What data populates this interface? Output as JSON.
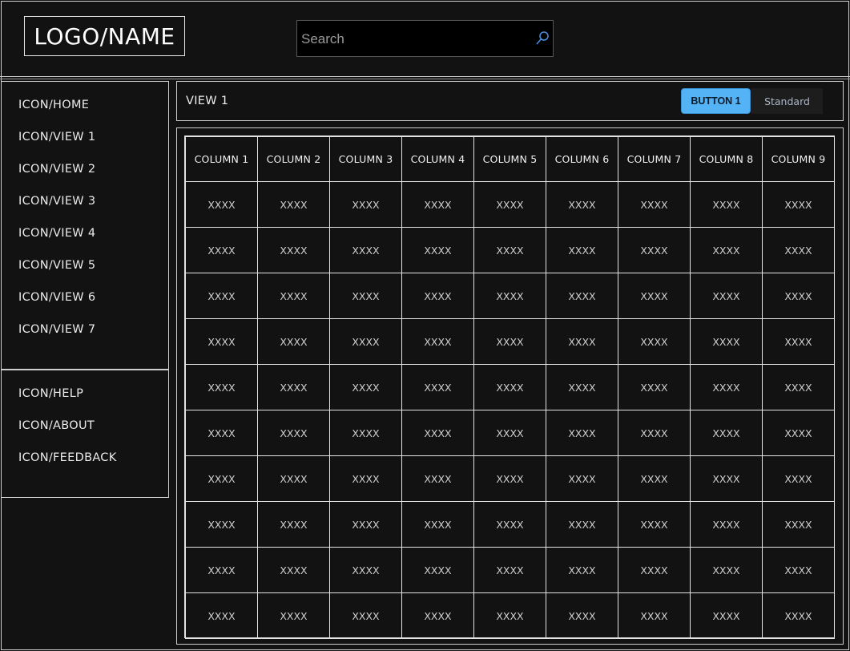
{
  "header": {
    "logo": "LOGO/NAME",
    "search": {
      "placeholder": "Search",
      "value": "",
      "icon": "search-icon"
    }
  },
  "sidebar": {
    "items": [
      {
        "label": "ICON/HOME"
      },
      {
        "label": "ICON/VIEW 1"
      },
      {
        "label": "ICON/VIEW 2"
      },
      {
        "label": "ICON/VIEW 3"
      },
      {
        "label": "ICON/VIEW 4"
      },
      {
        "label": "ICON/VIEW 5"
      },
      {
        "label": "ICON/VIEW 6"
      },
      {
        "label": "ICON/VIEW 7"
      }
    ],
    "footer_items": [
      {
        "label": "ICON/HELP"
      },
      {
        "label": "ICON/ABOUT"
      },
      {
        "label": "ICON/FEEDBACK"
      }
    ]
  },
  "main": {
    "view_title": "VIEW 1",
    "buttons": {
      "primary": "BUTTON 1",
      "secondary": "Standard"
    },
    "table": {
      "columns": [
        "COLUMN 1",
        "COLUMN 2",
        "COLUMN 3",
        "COLUMN 4",
        "COLUMN 5",
        "COLUMN 6",
        "COLUMN 7",
        "COLUMN 8",
        "COLUMN 9"
      ],
      "rows": [
        [
          "XXXX",
          "XXXX",
          "XXXX",
          "XXXX",
          "XXXX",
          "XXXX",
          "XXXX",
          "XXXX",
          "XXXX"
        ],
        [
          "XXXX",
          "XXXX",
          "XXXX",
          "XXXX",
          "XXXX",
          "XXXX",
          "XXXX",
          "XXXX",
          "XXXX"
        ],
        [
          "XXXX",
          "XXXX",
          "XXXX",
          "XXXX",
          "XXXX",
          "XXXX",
          "XXXX",
          "XXXX",
          "XXXX"
        ],
        [
          "XXXX",
          "XXXX",
          "XXXX",
          "XXXX",
          "XXXX",
          "XXXX",
          "XXXX",
          "XXXX",
          "XXXX"
        ],
        [
          "XXXX",
          "XXXX",
          "XXXX",
          "XXXX",
          "XXXX",
          "XXXX",
          "XXXX",
          "XXXX",
          "XXXX"
        ],
        [
          "XXXX",
          "XXXX",
          "XXXX",
          "XXXX",
          "XXXX",
          "XXXX",
          "XXXX",
          "XXXX",
          "XXXX"
        ],
        [
          "XXXX",
          "XXXX",
          "XXXX",
          "XXXX",
          "XXXX",
          "XXXX",
          "XXXX",
          "XXXX",
          "XXXX"
        ],
        [
          "XXXX",
          "XXXX",
          "XXXX",
          "XXXX",
          "XXXX",
          "XXXX",
          "XXXX",
          "XXXX",
          "XXXX"
        ],
        [
          "XXXX",
          "XXXX",
          "XXXX",
          "XXXX",
          "XXXX",
          "XXXX",
          "XXXX",
          "XXXX",
          "XXXX"
        ],
        [
          "XXXX",
          "XXXX",
          "XXXX",
          "XXXX",
          "XXXX",
          "XXXX",
          "XXXX",
          "XXXX",
          "XXXX"
        ]
      ]
    }
  },
  "colors": {
    "background": "#121212",
    "accent": "#54b3f5",
    "line": "#e4e4e4",
    "search_icon": "#4a90e2"
  }
}
